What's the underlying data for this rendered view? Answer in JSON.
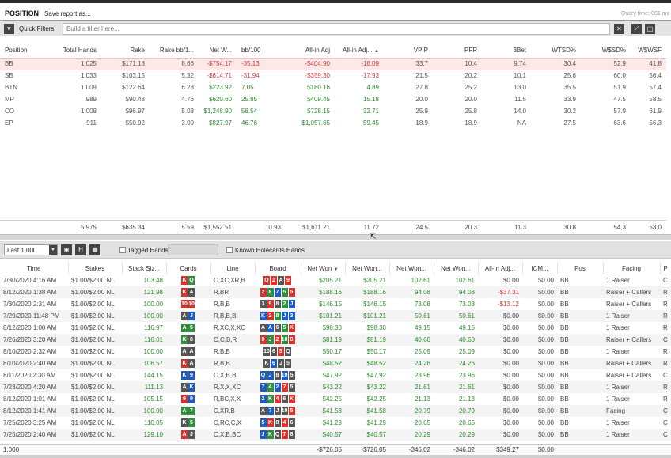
{
  "header": {
    "title": "POSITION",
    "save_link": "Save report as...",
    "query_time": "Query time: 001 ms"
  },
  "filter_bar": {
    "label": "Quick Filters",
    "placeholder": "Build a filter here...",
    "filter_icon": "filter-icon",
    "clear_icon": "close-icon",
    "chart_icon": "chart-icon",
    "layout_icon": "layout-icon"
  },
  "position_table": {
    "columns": [
      "Position",
      "Total Hands",
      "Rake",
      "Rake bb/1...",
      "Net W...",
      "bb/100",
      "All-in Adj",
      "All-in Adj...",
      "VPIP",
      "PFR",
      "3Bet",
      "WTSD%",
      "W$SD%",
      "W$WSF"
    ],
    "sorted_column_indicator": "▲",
    "rows": [
      [
        "BB",
        "1,025",
        "$171.18",
        "8.66",
        "-$754.17",
        "-35.13",
        "-$404.90",
        "-18.09",
        "33.7",
        "10.4",
        "9.74",
        "30.4",
        "52.9",
        "41.8"
      ],
      [
        "SB",
        "1,033",
        "$103.15",
        "5.32",
        "-$614.71",
        "-31.94",
        "-$359.30",
        "-17.93",
        "21.5",
        "20.2",
        "10.1",
        "25.6",
        "60.0",
        "56.4"
      ],
      [
        "BTN",
        "1,009",
        "$122.64",
        "6.28",
        "$223.92",
        "7.05",
        "$180.16",
        "4.89",
        "27.8",
        "25.2",
        "13.0",
        "35.5",
        "51.9",
        "57.4"
      ],
      [
        "MP",
        "989",
        "$90.48",
        "4.76",
        "$620.60",
        "25.85",
        "$409.45",
        "15.18",
        "20.0",
        "20.0",
        "11.5",
        "33.9",
        "47.5",
        "58.5"
      ],
      [
        "CO",
        "1,008",
        "$96.97",
        "5.08",
        "$1,248.90",
        "58.54",
        "$728.15",
        "32.71",
        "25.9",
        "25.8",
        "14.0",
        "30.2",
        "57.9",
        "61.9"
      ],
      [
        "EP",
        "911",
        "$50.92",
        "3.00",
        "$827.97",
        "46.76",
        "$1,057.65",
        "59.45",
        "18.9",
        "18.9",
        "NA",
        "27.5",
        "63.6",
        "56.3"
      ]
    ],
    "totals": [
      "",
      "5,975",
      "$635.34",
      "5.59",
      "$1,552.51",
      "10.93",
      "$1,611.21",
      "11.72",
      "24.5",
      "20.3",
      "11.3",
      "30.8",
      "54.3",
      "53.0"
    ]
  },
  "toolbar2": {
    "range_select": "Last 1,000",
    "eye_icon": "eye-icon",
    "h_button": "H",
    "grid_icon": "grid-icon",
    "tagged_label": "Tagged Hands",
    "known_holecards_label": "Known Holecards Hands"
  },
  "hands_table": {
    "columns": [
      "Time",
      "Stakes",
      "Stack Siz...",
      "Cards",
      "Line",
      "Board",
      "Net Won",
      "Net Won...",
      "Net Won...",
      "Net Won...",
      "All-In Adj...",
      "ICM...",
      "Pos",
      "Facing",
      "P"
    ],
    "sort_indicator": "▼",
    "rows": [
      {
        "time": "7/30/2020 4:16 AM",
        "stakes": "$1.00/$2.00 NL",
        "stack": "103.48",
        "cards": [
          [
            "K",
            "h"
          ],
          [
            "Q",
            "c"
          ]
        ],
        "line": "C,XC,XR,B",
        "board": [
          [
            "Q",
            "h"
          ],
          [
            "2",
            "h"
          ],
          [
            "A",
            "s"
          ],
          [
            "9",
            "h"
          ]
        ],
        "nw1": "$205.21",
        "nw2": "$205.21",
        "nw3": "102.61",
        "nw4": "102.61",
        "aia": "$0.00",
        "icm": "$0.00",
        "pos": "BB",
        "facing": "1 Raiser",
        "p": "C"
      },
      {
        "time": "8/12/2020 1:38 AM",
        "stakes": "$1.00/$2.00 NL",
        "stack": "121.98",
        "cards": [
          [
            "K",
            "h"
          ],
          [
            "A",
            "s"
          ]
        ],
        "line": "R,BR",
        "board": [
          [
            "2",
            "h"
          ],
          [
            "8",
            "c"
          ],
          [
            "7",
            "d"
          ],
          [
            "5",
            "c"
          ],
          [
            "5",
            "h"
          ]
        ],
        "nw1": "$188.16",
        "nw2": "$188.16",
        "nw3": "94.08",
        "nw4": "94.08",
        "aia": "-$37.31",
        "icm": "$0.00",
        "pos": "BB",
        "facing": "Raiser + Callers",
        "p": "R"
      },
      {
        "time": "7/30/2020 2:31 AM",
        "stakes": "$1.00/$2.00 NL",
        "stack": "100.00",
        "cards": [
          [
            "10",
            "h"
          ],
          [
            "10",
            "h"
          ]
        ],
        "line": "R,B,B",
        "board": [
          [
            "3",
            "s"
          ],
          [
            "9",
            "h"
          ],
          [
            "8",
            "s"
          ],
          [
            "2",
            "c"
          ],
          [
            "J",
            "d"
          ]
        ],
        "nw1": "$146.15",
        "nw2": "$146.15",
        "nw3": "73.08",
        "nw4": "73.08",
        "aia": "-$13.12",
        "icm": "$0.00",
        "pos": "BB",
        "facing": "Raiser + Callers",
        "p": "R"
      },
      {
        "time": "7/29/2020 11:48 PM",
        "stakes": "$1.00/$2.00 NL",
        "stack": "100.00",
        "cards": [
          [
            "A",
            "s"
          ],
          [
            "J",
            "d"
          ]
        ],
        "line": "R,B,B,B",
        "board": [
          [
            "K",
            "d"
          ],
          [
            "2",
            "h"
          ],
          [
            "8",
            "c"
          ],
          [
            "J",
            "d"
          ],
          [
            "3",
            "d"
          ]
        ],
        "nw1": "$101.21",
        "nw2": "$101.21",
        "nw3": "50.61",
        "nw4": "50.61",
        "aia": "$0.00",
        "icm": "$0.00",
        "pos": "BB",
        "facing": "1 Raiser",
        "p": "R"
      },
      {
        "time": "8/12/2020 1:00 AM",
        "stakes": "$1.00/$2.00 NL",
        "stack": "116.97",
        "cards": [
          [
            "A",
            "c"
          ],
          [
            "5",
            "c"
          ]
        ],
        "line": "R,XC,X,XC",
        "board": [
          [
            "A",
            "s"
          ],
          [
            "A",
            "d"
          ],
          [
            "6",
            "s"
          ],
          [
            "5",
            "c"
          ],
          [
            "K",
            "h"
          ]
        ],
        "nw1": "$98.30",
        "nw2": "$98.30",
        "nw3": "49.15",
        "nw4": "49.15",
        "aia": "$0.00",
        "icm": "$0.00",
        "pos": "BB",
        "facing": "1 Raiser",
        "p": "R"
      },
      {
        "time": "7/26/2020 3:20 AM",
        "stakes": "$1.00/$2.00 NL",
        "stack": "116.01",
        "cards": [
          [
            "K",
            "c"
          ],
          [
            "8",
            "s"
          ]
        ],
        "line": "C,C,B,R",
        "board": [
          [
            "8",
            "h"
          ],
          [
            "J",
            "c"
          ],
          [
            "2",
            "h"
          ],
          [
            "10",
            "c"
          ],
          [
            "8",
            "h"
          ]
        ],
        "nw1": "$81.19",
        "nw2": "$81.19",
        "nw3": "40.60",
        "nw4": "40.60",
        "aia": "$0.00",
        "icm": "$0.00",
        "pos": "BB",
        "facing": "Raiser + Callers",
        "p": "C"
      },
      {
        "time": "8/10/2020 2:32 AM",
        "stakes": "$1.00/$2.00 NL",
        "stack": "100.00",
        "cards": [
          [
            "A",
            "s"
          ],
          [
            "A",
            "s"
          ]
        ],
        "line": "R,B,B",
        "board": [
          [
            "10",
            "s"
          ],
          [
            "6",
            "s"
          ],
          [
            "5",
            "h"
          ],
          [
            "Q",
            "s"
          ]
        ],
        "nw1": "$50.17",
        "nw2": "$50.17",
        "nw3": "25.09",
        "nw4": "25.09",
        "aia": "$0.00",
        "icm": "$0.00",
        "pos": "BB",
        "facing": "1 Raiser",
        "p": "R"
      },
      {
        "time": "8/10/2020 2:40 AM",
        "stakes": "$1.00/$2.00 NL",
        "stack": "106.57",
        "cards": [
          [
            "K",
            "h"
          ],
          [
            "A",
            "s"
          ]
        ],
        "line": "R,B,B",
        "board": [
          [
            "K",
            "s"
          ],
          [
            "6",
            "d"
          ],
          [
            "J",
            "s"
          ],
          [
            "5",
            "s"
          ]
        ],
        "nw1": "$48.52",
        "nw2": "$48.52",
        "nw3": "24.26",
        "nw4": "24.26",
        "aia": "$0.00",
        "icm": "$0.00",
        "pos": "BB",
        "facing": "Raiser + Callers",
        "p": "R"
      },
      {
        "time": "8/11/2020 2:30 AM",
        "stakes": "$1.00/$2.00 NL",
        "stack": "144.15",
        "cards": [
          [
            "K",
            "d"
          ],
          [
            "9",
            "d"
          ]
        ],
        "line": "C,X,B,B",
        "board": [
          [
            "Q",
            "d"
          ],
          [
            "J",
            "d"
          ],
          [
            "8",
            "s"
          ],
          [
            "10",
            "d"
          ],
          [
            "5",
            "s"
          ]
        ],
        "nw1": "$47.92",
        "nw2": "$47.92",
        "nw3": "23.96",
        "nw4": "23.96",
        "aia": "$0.00",
        "icm": "$0.00",
        "pos": "BB",
        "facing": "Raiser + Callers",
        "p": "C"
      },
      {
        "time": "7/23/2020 4:20 AM",
        "stakes": "$1.00/$2.00 NL",
        "stack": "111.13",
        "cards": [
          [
            "A",
            "s"
          ],
          [
            "K",
            "d"
          ]
        ],
        "line": "R,X,X,XC",
        "board": [
          [
            "7",
            "d"
          ],
          [
            "4",
            "c"
          ],
          [
            "2",
            "d"
          ],
          [
            "7",
            "h"
          ],
          [
            "5",
            "s"
          ]
        ],
        "nw1": "$43.22",
        "nw2": "$43.22",
        "nw3": "21.61",
        "nw4": "21.61",
        "aia": "$0.00",
        "icm": "$0.00",
        "pos": "BB",
        "facing": "1 Raiser",
        "p": "R"
      },
      {
        "time": "8/12/2020 1:01 AM",
        "stakes": "$1.00/$2.00 NL",
        "stack": "105.15",
        "cards": [
          [
            "9",
            "h"
          ],
          [
            "9",
            "d"
          ]
        ],
        "line": "R,BC,X,X",
        "board": [
          [
            "2",
            "d"
          ],
          [
            "K",
            "c"
          ],
          [
            "4",
            "h"
          ],
          [
            "6",
            "s"
          ],
          [
            "K",
            "h"
          ]
        ],
        "nw1": "$42.25",
        "nw2": "$42.25",
        "nw3": "21.13",
        "nw4": "21.13",
        "aia": "$0.00",
        "icm": "$0.00",
        "pos": "BB",
        "facing": "1 Raiser",
        "p": "R"
      },
      {
        "time": "8/12/2020 1:41 AM",
        "stakes": "$1.00/$2.00 NL",
        "stack": "100.00",
        "cards": [
          [
            "A",
            "c"
          ],
          [
            "7",
            "c"
          ]
        ],
        "line": "C,XR,B",
        "board": [
          [
            "A",
            "s"
          ],
          [
            "7",
            "d"
          ],
          [
            "J",
            "s"
          ],
          [
            "10",
            "s"
          ],
          [
            "5",
            "h"
          ]
        ],
        "nw1": "$41.58",
        "nw2": "$41.58",
        "nw3": "20.79",
        "nw4": "20.79",
        "aia": "$0.00",
        "icm": "$0.00",
        "pos": "BB",
        "facing": "Facing",
        "p": "C"
      },
      {
        "time": "7/25/2020 3:25 AM",
        "stakes": "$1.00/$2.00 NL",
        "stack": "110.05",
        "cards": [
          [
            "K",
            "s"
          ],
          [
            "5",
            "c"
          ]
        ],
        "line": "C,RC,C,X",
        "board": [
          [
            "5",
            "d"
          ],
          [
            "K",
            "h"
          ],
          [
            "8",
            "s"
          ],
          [
            "4",
            "h"
          ],
          [
            "6",
            "s"
          ]
        ],
        "nw1": "$41.29",
        "nw2": "$41.29",
        "nw3": "20.65",
        "nw4": "20.65",
        "aia": "$0.00",
        "icm": "$0.00",
        "pos": "BB",
        "facing": "1 Raiser",
        "p": "C"
      },
      {
        "time": "7/25/2020 2:40 AM",
        "stakes": "$1.00/$2.00 NL",
        "stack": "129.10",
        "cards": [
          [
            "A",
            "h"
          ],
          [
            "J",
            "s"
          ]
        ],
        "line": "C,X,B,BC",
        "board": [
          [
            "J",
            "d"
          ],
          [
            "K",
            "c"
          ],
          [
            "Q",
            "s"
          ],
          [
            "7",
            "h"
          ],
          [
            "8",
            "s"
          ]
        ],
        "nw1": "$40.57",
        "nw2": "$40.57",
        "nw3": "20.29",
        "nw4": "20.29",
        "aia": "$0.00",
        "icm": "$0.00",
        "pos": "BB",
        "facing": "1 Raiser",
        "p": "C"
      }
    ],
    "totals": {
      "count": "1,000",
      "nw1": "-$726.05",
      "nw2": "-$726.05",
      "nw3": "-346.02",
      "nw4": "-346.02",
      "aia": "$349.27",
      "icm": "$0.00"
    }
  },
  "colors": {
    "negative": "#d23a3a",
    "positive": "#2f8a2f",
    "heart": "#d8322a",
    "diamond": "#1c5bc4",
    "club": "#2c8f3c",
    "spade": "#555555",
    "selected_row": "#fde8e8"
  }
}
